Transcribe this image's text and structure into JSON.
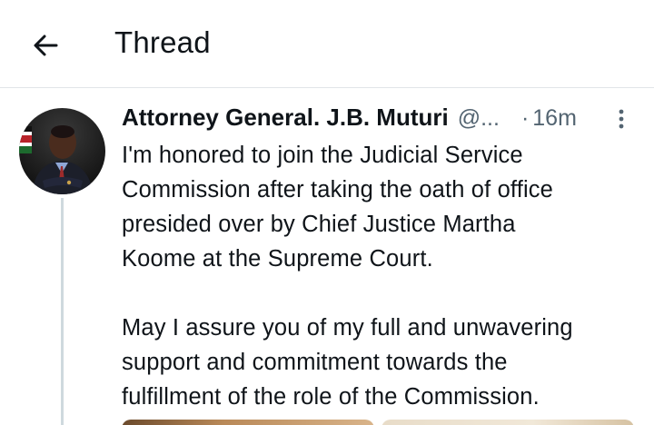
{
  "header": {
    "title": "Thread",
    "back_icon": "arrow-left-icon"
  },
  "tweet": {
    "author_name": "Attorney General. J.B. Muturi",
    "handle": "@...",
    "separator": "·",
    "time": "16m",
    "more_icon": "more-vertical-icon",
    "text_paragraph_1": [
      "I'm honored to join the Judicial Service",
      "Commission after taking the oath of office",
      "presided over by Chief Justice Martha",
      "Koome at the Supreme Court."
    ],
    "text_paragraph_2": [
      "May I assure you of my full and unwavering",
      "support and commitment towards the",
      "fulfillment of the role of the Commission."
    ],
    "media_count": 2
  },
  "colors": {
    "text_primary": "#0f1419",
    "text_secondary": "#536471",
    "divider": "#e1e5e8",
    "thread_line": "#cfd9de"
  }
}
